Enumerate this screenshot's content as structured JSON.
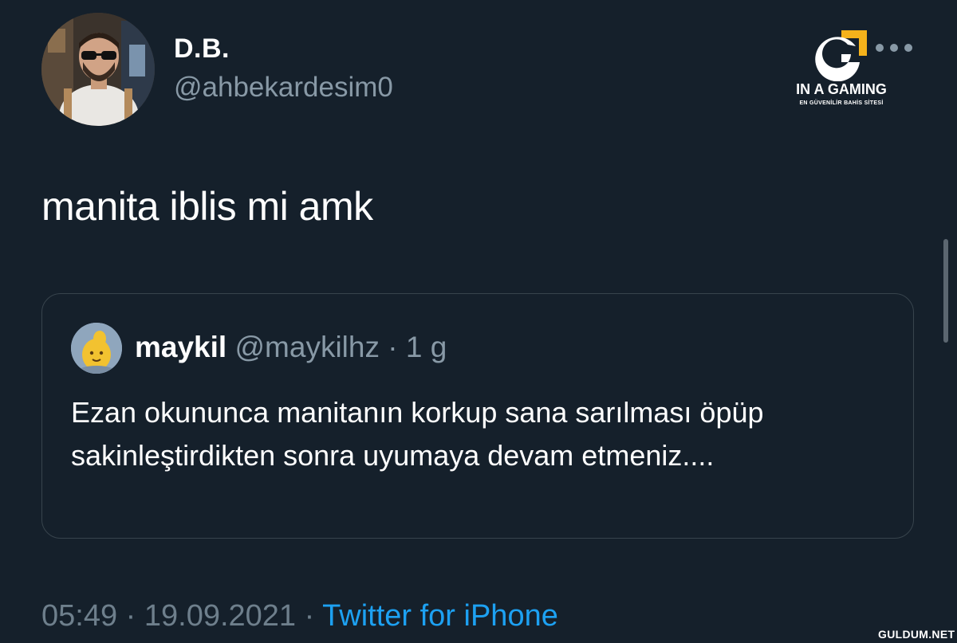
{
  "author": {
    "display_name": "D.B.",
    "handle": "@ahbekardesim0"
  },
  "tweet": {
    "text": "manita iblis mi amk",
    "time": "05:49",
    "date": "19.09.2021",
    "separator": "·",
    "source": "Twitter for iPhone"
  },
  "quoted_tweet": {
    "display_name": "maykil",
    "handle": "@maykilhz",
    "separator": "·",
    "age": "1 g",
    "text": "Ezan okununca manitanın korkup sana sarılması öpüp sakinleştirdikten sonra uyumaya devam etmeniz...."
  },
  "brand_overlay": {
    "name": "IN A GAMING",
    "tagline": "EN GÜVENİLİR BAHİS SİTESİ",
    "accent_color": "#f5b21b"
  },
  "watermark": "GULDUM.NET",
  "colors": {
    "background": "#15202b",
    "secondary_text": "#8899a6",
    "link": "#1da1f2",
    "border": "#38444d"
  },
  "icons": {
    "more": "more-horizontal-icon",
    "brand": "brand-g-logo-icon"
  }
}
